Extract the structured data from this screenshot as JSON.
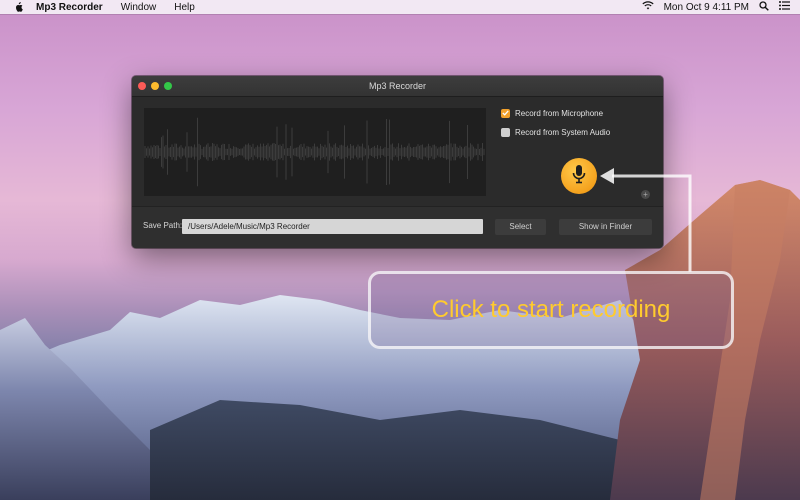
{
  "menubar": {
    "app_name": "Mp3 Recorder",
    "menus": [
      "Window",
      "Help"
    ],
    "clock": "Mon Oct 9  4:11 PM"
  },
  "window": {
    "title": "Mp3 Recorder",
    "options": {
      "microphone": {
        "label": "Record from Microphone",
        "checked": true
      },
      "system_audio": {
        "label": "Record from System Audio",
        "checked": false
      }
    },
    "save_path": {
      "label": "Save Path:",
      "value": "/Users/Adele/Music/Mp3 Recorder"
    },
    "select_label": "Select",
    "show_in_finder_label": "Show in Finder"
  },
  "callout": {
    "text": "Click to start recording"
  },
  "colors": {
    "accent": "#f2a12b",
    "callout_text": "#ffcb2e",
    "window_bg": "#2b2b2b"
  },
  "icons": [
    "apple-icon",
    "wifi-icon",
    "search-icon",
    "list-icon",
    "microphone-icon",
    "plus-icon"
  ]
}
